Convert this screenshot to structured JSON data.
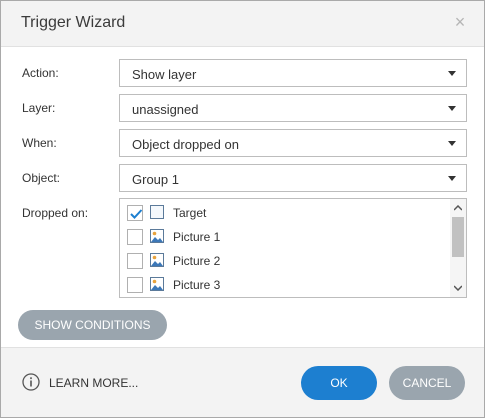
{
  "dialog": {
    "title": "Trigger Wizard",
    "close_glyph": "×"
  },
  "fields": {
    "action": {
      "label": "Action:",
      "value": "Show layer"
    },
    "layer": {
      "label": "Layer:",
      "value": "unassigned"
    },
    "when": {
      "label": "When:",
      "value": "Object dropped on"
    },
    "object": {
      "label": "Object:",
      "value": "Group 1"
    }
  },
  "dropped_on": {
    "label": "Dropped on:",
    "items": [
      {
        "label": "Target",
        "checked": true,
        "icon": "shape-icon"
      },
      {
        "label": "Picture 1",
        "checked": false,
        "icon": "picture-icon"
      },
      {
        "label": "Picture 2",
        "checked": false,
        "icon": "picture-icon"
      },
      {
        "label": "Picture 3",
        "checked": false,
        "icon": "picture-icon"
      }
    ]
  },
  "buttons": {
    "show_conditions": "SHOW CONDITIONS",
    "learn_more": "LEARN MORE...",
    "ok": "OK",
    "cancel": "CANCEL"
  },
  "colors": {
    "primary": "#1d7fd0",
    "secondary": "#9aa5ae",
    "check": "#1d7fd0"
  }
}
